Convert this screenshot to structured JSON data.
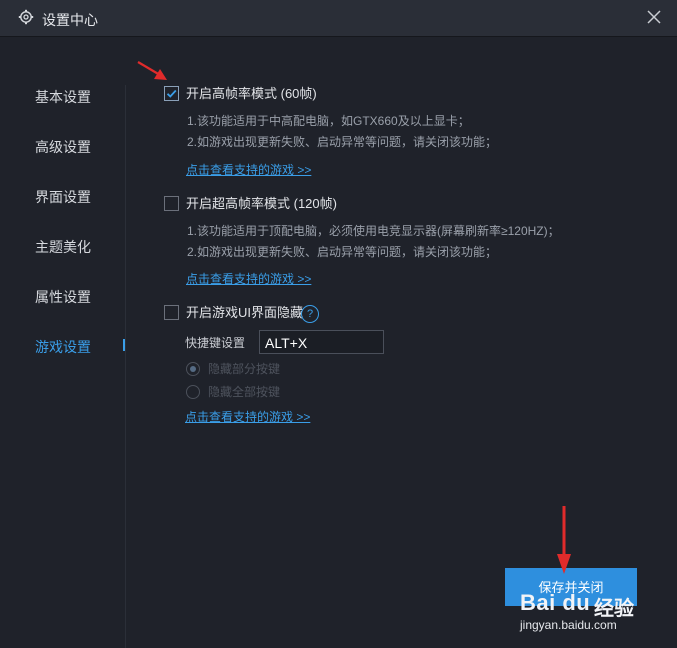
{
  "window": {
    "title": "设置中心"
  },
  "sidebar": {
    "items": [
      {
        "label": "基本设置"
      },
      {
        "label": "高级设置"
      },
      {
        "label": "界面设置"
      },
      {
        "label": "主题美化"
      },
      {
        "label": "属性设置"
      },
      {
        "label": "游戏设置",
        "active": true
      }
    ]
  },
  "main": {
    "high_fps": {
      "checked": true,
      "label": "开启高帧率模式 (60帧)",
      "notes": [
        "1.该功能适用于中高配电脑，如GTX660及以上显卡；",
        "2.如游戏出现更新失败、启动异常等问题，请关闭该功能；"
      ],
      "link": "点击查看支持的游戏 >>"
    },
    "ultra_fps": {
      "checked": false,
      "label": "开启超高帧率模式 (120帧)",
      "notes": [
        "1.该功能适用于顶配电脑，必须使用电竞显示器(屏幕刷新率≥120HZ)；",
        "2.如游戏出现更新失败、启动异常等问题，请关闭该功能；"
      ],
      "link": "点击查看支持的游戏 >>"
    },
    "hide_ui": {
      "checked": false,
      "label": "开启游戏UI界面隐藏",
      "help_glyph": "?",
      "hotkey_label": "快捷键设置",
      "hotkey_value": "ALT+X",
      "options": [
        {
          "label": "隐藏部分按键",
          "selected": true
        },
        {
          "label": "隐藏全部按键",
          "selected": false
        }
      ],
      "link": "点击查看支持的游戏 >>"
    },
    "save_button": "保存并关闭"
  },
  "watermark": {
    "brand": "Bai du",
    "cn": "经验",
    "url": "jingyan.baidu.com"
  },
  "colors": {
    "background": "#1f222a",
    "titlebar": "#2a2e37",
    "accent": "#3a9ee8",
    "button": "#2e8fde",
    "annotation_arrow": "#e02b2b"
  }
}
